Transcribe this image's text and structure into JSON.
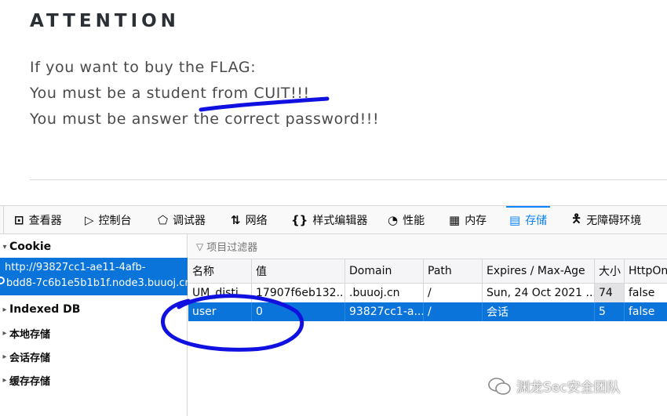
{
  "page": {
    "heading": "ATTENTION",
    "lines": [
      "If you want to buy the FLAG:",
      "You must be a student from CUIT!!!",
      "You must be answer the correct password!!!"
    ]
  },
  "toolbar": {
    "tabs": [
      {
        "label": "查看器",
        "icon": "inspector-icon"
      },
      {
        "label": "控制台",
        "icon": "console-icon"
      },
      {
        "label": "调试器",
        "icon": "debugger-icon"
      },
      {
        "label": "网络",
        "icon": "network-icon"
      },
      {
        "label": "样式编辑器",
        "icon": "style-editor-icon"
      },
      {
        "label": "性能",
        "icon": "performance-icon"
      },
      {
        "label": "内存",
        "icon": "memory-icon"
      },
      {
        "label": "存储",
        "icon": "storage-icon"
      },
      {
        "label": "无障碍环境",
        "icon": "accessibility-icon"
      }
    ],
    "active_tab": "存储",
    "accent_color": "#0a84ff"
  },
  "sidebar": {
    "cookie_label": "Cookie",
    "selected_host_line1": "http://93827cc1-ae11-4afb-",
    "selected_host_line2": "bdd8-7c6b1e5b1b1f.node3.buuoj.cn",
    "indexed_db": "Indexed DB",
    "local_storage": "本地存储",
    "session_storage": "会话存储",
    "cache_storage": "缓存存储"
  },
  "filter": {
    "placeholder": "项目过滤器"
  },
  "table": {
    "columns": [
      "名称",
      "值",
      "Domain",
      "Path",
      "Expires / Max-Age",
      "大小",
      "HttpOnly"
    ],
    "rows": [
      {
        "name": "UM_disti",
        "value": "17907f6eb132...",
        "domain": ".buuoj.cn",
        "path": "/",
        "expires": "Sun, 24 Oct 2021 ...",
        "size": "74",
        "httponly": "false"
      },
      {
        "name": "user",
        "value": "0",
        "domain": "93827cc1-a...",
        "path": "/",
        "expires": "会话",
        "size": "5",
        "httponly": "false"
      }
    ]
  },
  "watermark": {
    "text": "渊龙Sec安全团队"
  }
}
